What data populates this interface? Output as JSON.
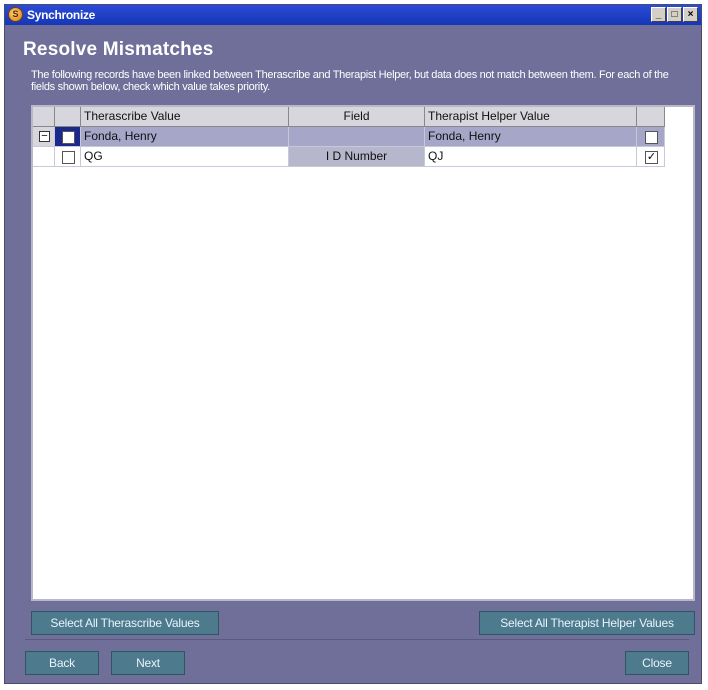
{
  "window": {
    "title": "Synchronize"
  },
  "page": {
    "heading": "Resolve Mismatches",
    "description": "The following records have been linked between Therascribe and Therapist Helper, but data does not match between them.  For each of the fields shown below, check which value takes priority."
  },
  "grid": {
    "columns": [
      "Therascribe Value",
      "Field",
      "Therapist Helper Value"
    ],
    "rows": [
      {
        "therascribe": "Fonda, Henry",
        "field": "",
        "helper": "Fonda, Henry",
        "therascribe_checked": false,
        "helper_checked": false,
        "expanded": true
      },
      {
        "therascribe": "QG",
        "field": "I D Number",
        "helper": "QJ",
        "therascribe_checked": false,
        "helper_checked": true
      }
    ]
  },
  "buttons": {
    "select_all_therascribe": "Select All Therascribe Values",
    "select_all_helper": "Select All Therapist Helper Values",
    "back": "Back",
    "next": "Next",
    "close": "Close"
  },
  "icons": {
    "app": "synchronize-app-icon",
    "minimize": "minimize-icon",
    "maximize": "maximize-icon",
    "close": "close-icon",
    "expander": "collapse-minus-icon"
  },
  "colors": {
    "window_bg": "#6f6f9a",
    "titlebar": "#1f40c8",
    "button": "#4e7a8e",
    "selected_row": "#a6a6c8"
  }
}
